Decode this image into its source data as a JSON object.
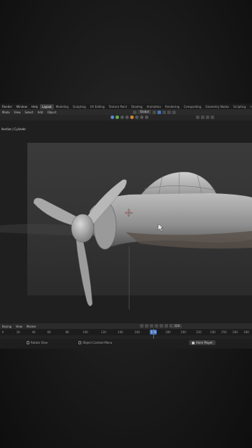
{
  "menu": {
    "items": [
      "Render",
      "Window",
      "Help"
    ]
  },
  "workspaces": [
    "Layout",
    "Modeling",
    "Sculpting",
    "UV Editing",
    "Texture Paint",
    "Shading",
    "Animation",
    "Rendering",
    "Compositing",
    "Geometry Nodes",
    "Scripting"
  ],
  "workspaces_active": "Layout",
  "header": {
    "items": [
      "Mode",
      "View",
      "Select",
      "Add",
      "Object"
    ],
    "transform": "Global"
  },
  "viewport": {
    "label": "llection | Cylinder"
  },
  "timeline": {
    "items": [
      "Keying",
      "View",
      "Marker"
    ],
    "current_frame": "119"
  },
  "ruler": {
    "ticks": [
      "0",
      "20",
      "40",
      "60",
      "80",
      "100",
      "120",
      "140",
      "160",
      "180",
      "200",
      "220",
      "240",
      "250",
      "260",
      "280"
    ]
  },
  "status": {
    "rotate": "Rotate View",
    "context": "Object Context Menu",
    "anim": "Anim Player"
  }
}
